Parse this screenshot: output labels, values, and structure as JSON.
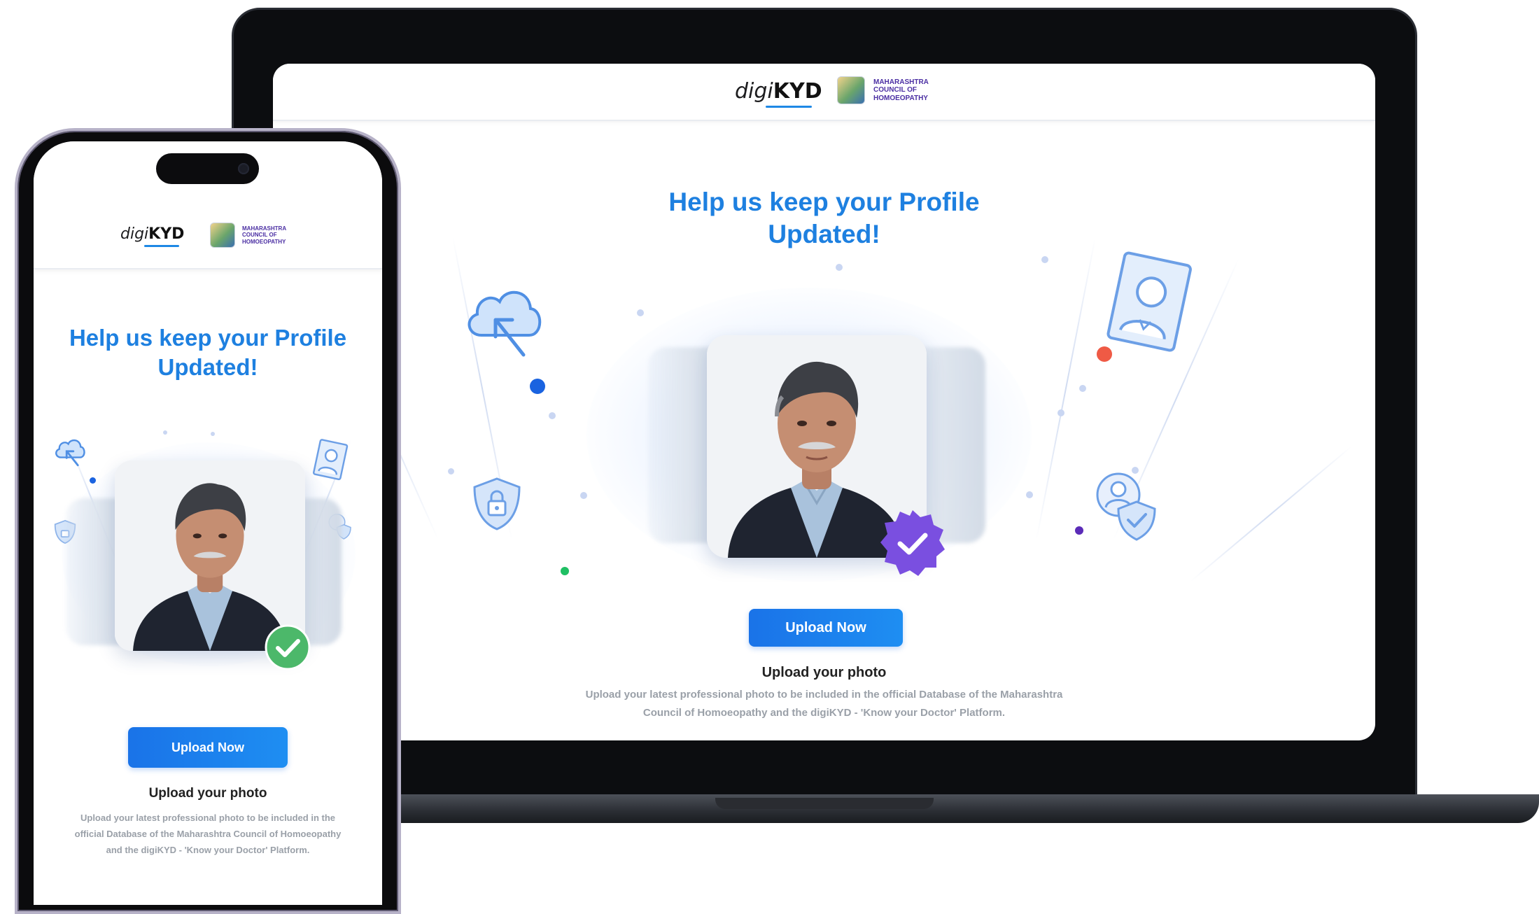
{
  "brand": {
    "logo_prefix": "digi",
    "logo_suffix": "KYD",
    "council_lines": [
      "MAHARASHTRA",
      "COUNCIL OF",
      "HOMOEOPATHY"
    ]
  },
  "desktop": {
    "title_line1": "Help us keep your Profile",
    "title_line2": "Updated!",
    "upload_button": "Upload Now",
    "section_heading": "Upload your photo",
    "description_line1": "Upload your latest professional photo to be included in the official Database of the Maharashtra",
    "description_line2": "Council of Homoeopathy and the digiKYD - 'Know your Doctor' Platform."
  },
  "mobile": {
    "title_line1": "Help us keep your Profile",
    "title_line2": "Updated!",
    "upload_button": "Upload Now",
    "section_heading": "Upload your photo",
    "description_line1": "Upload your latest professional photo to be included in the",
    "description_line2": "official Database of the Maharashtra Council of Homoeopathy",
    "description_line3": "and the digiKYD - 'Know your Doctor' Platform."
  },
  "icons": {
    "cloud": "cloud-upload-icon",
    "shield": "shield-lock-icon",
    "id_card": "id-card-icon",
    "user_shield": "user-shield-icon",
    "verified_desktop": "verified-badge-icon",
    "verified_mobile": "check-circle-icon"
  },
  "colors": {
    "primary": "#1a73e8",
    "title": "#1e80e0",
    "badge_purple": "#7a4fe0",
    "badge_green": "#4cb86a",
    "council_text": "#4b2fa3"
  }
}
